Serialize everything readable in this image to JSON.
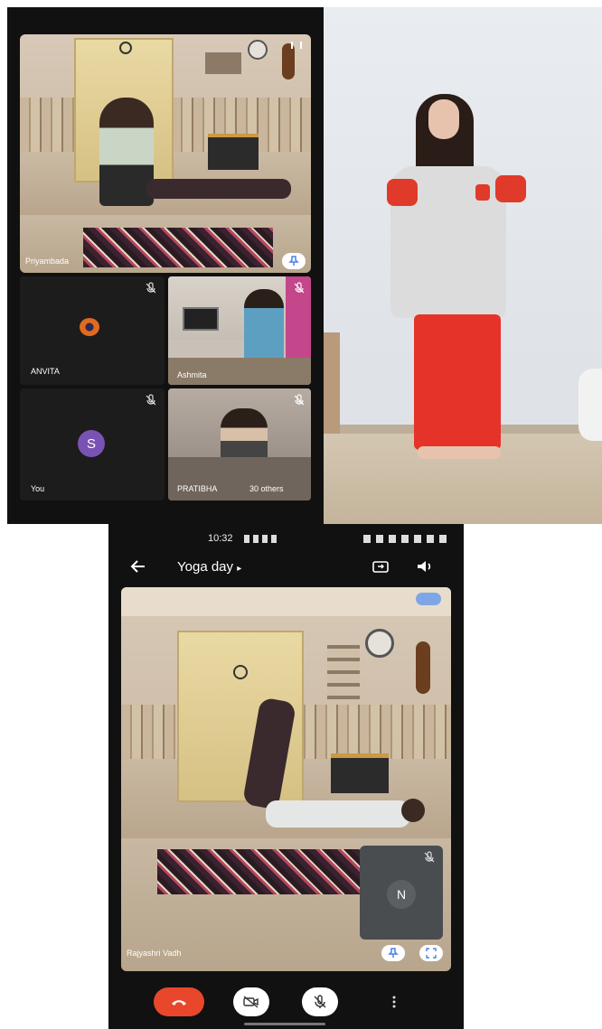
{
  "top_call": {
    "participants": [
      {
        "name": "Priyambada",
        "tile": "main"
      },
      {
        "name": "ANVITA",
        "tile": "grid-1"
      },
      {
        "name": "Ashmita",
        "tile": "grid-2"
      },
      {
        "name": "You",
        "tile": "grid-3",
        "avatar_letter": "S"
      },
      {
        "name": "PRATIBHA",
        "tile": "grid-4"
      }
    ],
    "others_label": "30 others"
  },
  "bottom_call": {
    "status_time": "10:32",
    "meeting_title": "Yoga day",
    "main_name": "Rajyashri Vadh",
    "self_avatar_letter": "N"
  },
  "colors": {
    "end_call": "#e8472c",
    "avatar_purple": "#7a52b3",
    "avatar_gray": "#5a5f63",
    "app_bg": "#111111",
    "pin_blue": "#4a80e8"
  }
}
